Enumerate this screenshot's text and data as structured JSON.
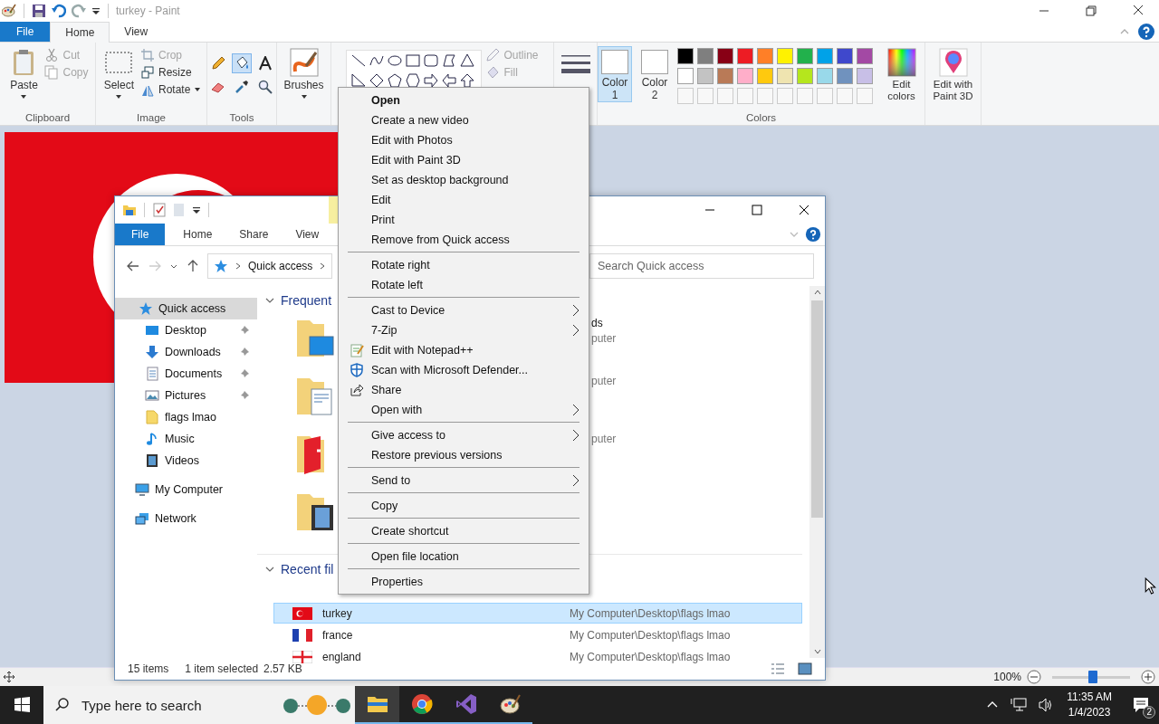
{
  "paint": {
    "title": "turkey - Paint",
    "tabs": [
      {
        "label": "File",
        "kind": "file",
        "selected": false
      },
      {
        "label": "Home",
        "kind": "tab",
        "selected": true
      },
      {
        "label": "View",
        "kind": "tab",
        "selected": false
      }
    ],
    "clipboard": {
      "label": "Clipboard",
      "paste": "Paste",
      "cut": {
        "label": "Cut",
        "disabled": true
      },
      "copy": {
        "label": "Copy",
        "disabled": true
      }
    },
    "image": {
      "label": "Image",
      "select": "Select",
      "crop": {
        "label": "Crop",
        "disabled": true
      },
      "resize": {
        "label": "Resize",
        "disabled": false
      },
      "rotate": {
        "label": "Rotate",
        "disabled": false
      }
    },
    "tools": {
      "label": "Tools",
      "items": [
        {
          "kind": "pencil",
          "selected": false
        },
        {
          "kind": "fill",
          "selected": true
        },
        {
          "kind": "text",
          "selected": false
        },
        {
          "kind": "eraser",
          "selected": false
        },
        {
          "kind": "picker",
          "selected": false
        },
        {
          "kind": "magnifier",
          "selected": false
        }
      ]
    },
    "brushes": "Brushes",
    "shapes": {
      "outline": {
        "label": "Outline",
        "disabled": true
      },
      "fill": {
        "label": "Fill",
        "disabled": true
      }
    },
    "colors": {
      "label": "Colors",
      "slots": [
        {
          "label": "Color 1",
          "selected": true,
          "color": "#ffffff"
        },
        {
          "label": "Color 2",
          "selected": false,
          "color": "#ffffff"
        }
      ],
      "palette": [
        [
          {
            "color": "#000000"
          },
          {
            "color": "#7f7f7f"
          },
          {
            "color": "#880015"
          },
          {
            "color": "#ed1c24"
          },
          {
            "color": "#ff7f27"
          },
          {
            "color": "#fff200"
          },
          {
            "color": "#22b14c"
          },
          {
            "color": "#00a2e8"
          },
          {
            "color": "#3f48cc"
          },
          {
            "color": "#a349a4"
          }
        ],
        [
          {
            "color": "#ffffff"
          },
          {
            "color": "#c3c3c3"
          },
          {
            "color": "#b97a57"
          },
          {
            "color": "#ffaec9"
          },
          {
            "color": "#ffc90e"
          },
          {
            "color": "#efe4b0"
          },
          {
            "color": "#b5e61d"
          },
          {
            "color": "#99d9ea"
          },
          {
            "color": "#7092be"
          },
          {
            "color": "#c8bfe7"
          }
        ]
      ],
      "edit": "Edit colors"
    },
    "paint3d": "Edit with Paint 3D",
    "status": {
      "zoom": "100%",
      "level": 0.52
    }
  },
  "explorer": {
    "tabs": [
      {
        "label": "File",
        "kind": "file",
        "selected": false
      },
      {
        "label": "Home",
        "kind": "tab",
        "selected": false
      },
      {
        "label": "Share",
        "kind": "tab",
        "selected": false
      },
      {
        "label": "View",
        "kind": "tab",
        "selected": false
      }
    ],
    "address": "Quick access",
    "search": {
      "placeholder": "Search Quick access"
    },
    "sidebar": [
      {
        "label": "Quick access",
        "selected": true,
        "children": [
          {
            "label": "Desktop",
            "pinned": true,
            "selected": false
          },
          {
            "label": "Downloads",
            "pinned": true,
            "selected": false
          },
          {
            "label": "Documents",
            "pinned": true,
            "selected": false
          },
          {
            "label": "Pictures",
            "pinned": true,
            "selected": false
          },
          {
            "label": "flags lmao",
            "pinned": false,
            "selected": false
          },
          {
            "label": "Music",
            "pinned": false,
            "selected": false
          },
          {
            "label": "Videos",
            "pinned": false,
            "selected": false
          }
        ]
      },
      {
        "label": "My Computer",
        "selected": false
      },
      {
        "label": "Network",
        "selected": false
      }
    ],
    "frequent": {
      "heading": "Frequent",
      "tiles": [
        {
          "name": "ds",
          "location": "puter"
        },
        {
          "location": "puter"
        },
        {
          "location": "puter"
        }
      ]
    },
    "recent": {
      "heading": "Recent fil",
      "rows": [
        {
          "name": "turkey",
          "path": "My Computer\\Desktop\\flags lmao",
          "selected": true
        },
        {
          "name": "france",
          "path": "My Computer\\Desktop\\flags lmao",
          "selected": false
        },
        {
          "name": "england",
          "path": "My Computer\\Desktop\\flags lmao",
          "selected": false
        }
      ]
    },
    "status": {
      "count": "15 items",
      "selection": "1 item selected",
      "size": "2.57 KB"
    }
  },
  "menu": [
    {
      "kind": "item",
      "label": "Open",
      "default": true
    },
    {
      "kind": "item",
      "label": "Create a new video",
      "default": false
    },
    {
      "kind": "item",
      "label": "Edit with Photos",
      "default": false
    },
    {
      "kind": "item",
      "label": "Edit with Paint 3D",
      "default": false
    },
    {
      "kind": "item",
      "label": "Set as desktop background",
      "default": false
    },
    {
      "kind": "item",
      "label": "Edit",
      "default": false
    },
    {
      "kind": "item",
      "label": "Print",
      "default": false
    },
    {
      "kind": "item",
      "label": "Remove from Quick access",
      "default": false
    },
    {
      "kind": "separator"
    },
    {
      "kind": "item",
      "label": "Rotate right",
      "default": false
    },
    {
      "kind": "item",
      "label": "Rotate left",
      "default": false
    },
    {
      "kind": "separator"
    },
    {
      "kind": "item",
      "label": "Cast to Device",
      "default": false,
      "submenu": true
    },
    {
      "kind": "item",
      "label": "7-Zip",
      "default": false,
      "submenu": true
    },
    {
      "kind": "item",
      "label": "Edit with Notepad++",
      "default": false
    },
    {
      "kind": "item",
      "label": "Scan with Microsoft Defender...",
      "default": false
    },
    {
      "kind": "item",
      "label": "Share",
      "default": false
    },
    {
      "kind": "item",
      "label": "Open with",
      "default": false,
      "submenu": true
    },
    {
      "kind": "separator"
    },
    {
      "kind": "item",
      "label": "Give access to",
      "default": false,
      "submenu": true
    },
    {
      "kind": "item",
      "label": "Restore previous versions",
      "default": false
    },
    {
      "kind": "separator"
    },
    {
      "kind": "item",
      "label": "Send to",
      "default": false,
      "submenu": true
    },
    {
      "kind": "separator"
    },
    {
      "kind": "item",
      "label": "Copy",
      "default": false
    },
    {
      "kind": "separator"
    },
    {
      "kind": "item",
      "label": "Create shortcut",
      "default": false
    },
    {
      "kind": "separator"
    },
    {
      "kind": "item",
      "label": "Open file location",
      "default": false
    },
    {
      "kind": "separator"
    },
    {
      "kind": "item",
      "label": "Properties",
      "default": false
    }
  ],
  "taskbar": {
    "search": {
      "placeholder": "Type here to search"
    },
    "apps": [
      {
        "active": true
      },
      {
        "active": false
      },
      {
        "active": false
      },
      {
        "active": false
      }
    ],
    "time": "11:35 AM",
    "date": "1/4/2023",
    "notifications": "2"
  }
}
